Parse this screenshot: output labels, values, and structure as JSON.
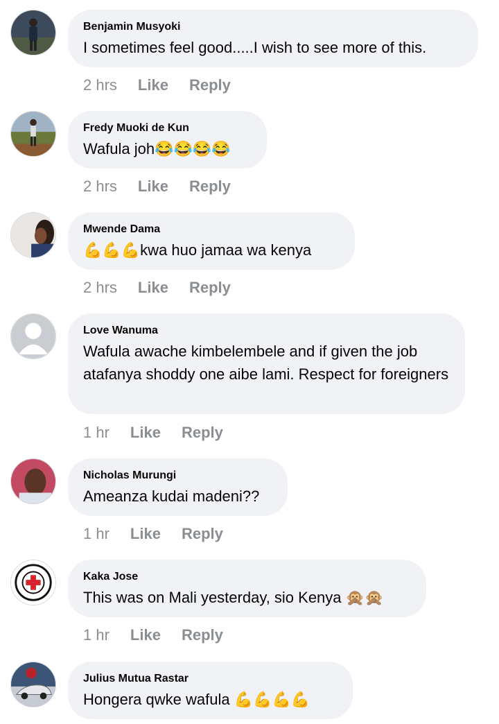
{
  "comments": [
    {
      "author": "Benjamin Musyoki",
      "text": "I sometimes feel good.....I wish to see more of this.",
      "time": "2 hrs",
      "like": "Like",
      "reply": "Reply",
      "avatar": "person-standing-photo"
    },
    {
      "author": "Fredy Muoki de Kun",
      "text": "Wafula joh😂😂😂😂",
      "time": "2 hrs",
      "like": "Like",
      "reply": "Reply",
      "avatar": "person-field-photo"
    },
    {
      "author": "Mwende Dama",
      "text": "💪💪💪kwa huo  jamaa wa kenya",
      "time": "2 hrs",
      "like": "Like",
      "reply": "Reply",
      "avatar": "woman-photo"
    },
    {
      "author": "Love Wanuma",
      "text": "Wafula awache kimbelembele and if given the job atafanya shoddy one aibe lami. Respect for foreigners",
      "time": "1 hr",
      "like": "Like",
      "reply": "Reply",
      "avatar": "default-user"
    },
    {
      "author": "Nicholas Murungi",
      "text": "Ameanza kudai madeni??",
      "time": "1 hr",
      "like": "Like",
      "reply": "Reply",
      "avatar": "man-photo"
    },
    {
      "author": "Kaka Jose",
      "text": "This was on Mali yesterday, sio Kenya 🙊🙊",
      "time": "1 hr",
      "like": "Like",
      "reply": "Reply",
      "avatar": "red-cross-logo"
    },
    {
      "author": "Julius Mutua Rastar",
      "text": "Hongera qwke wafula 💪💪💪💪",
      "time": "",
      "like": "",
      "reply": "",
      "avatar": "car-photo"
    }
  ]
}
